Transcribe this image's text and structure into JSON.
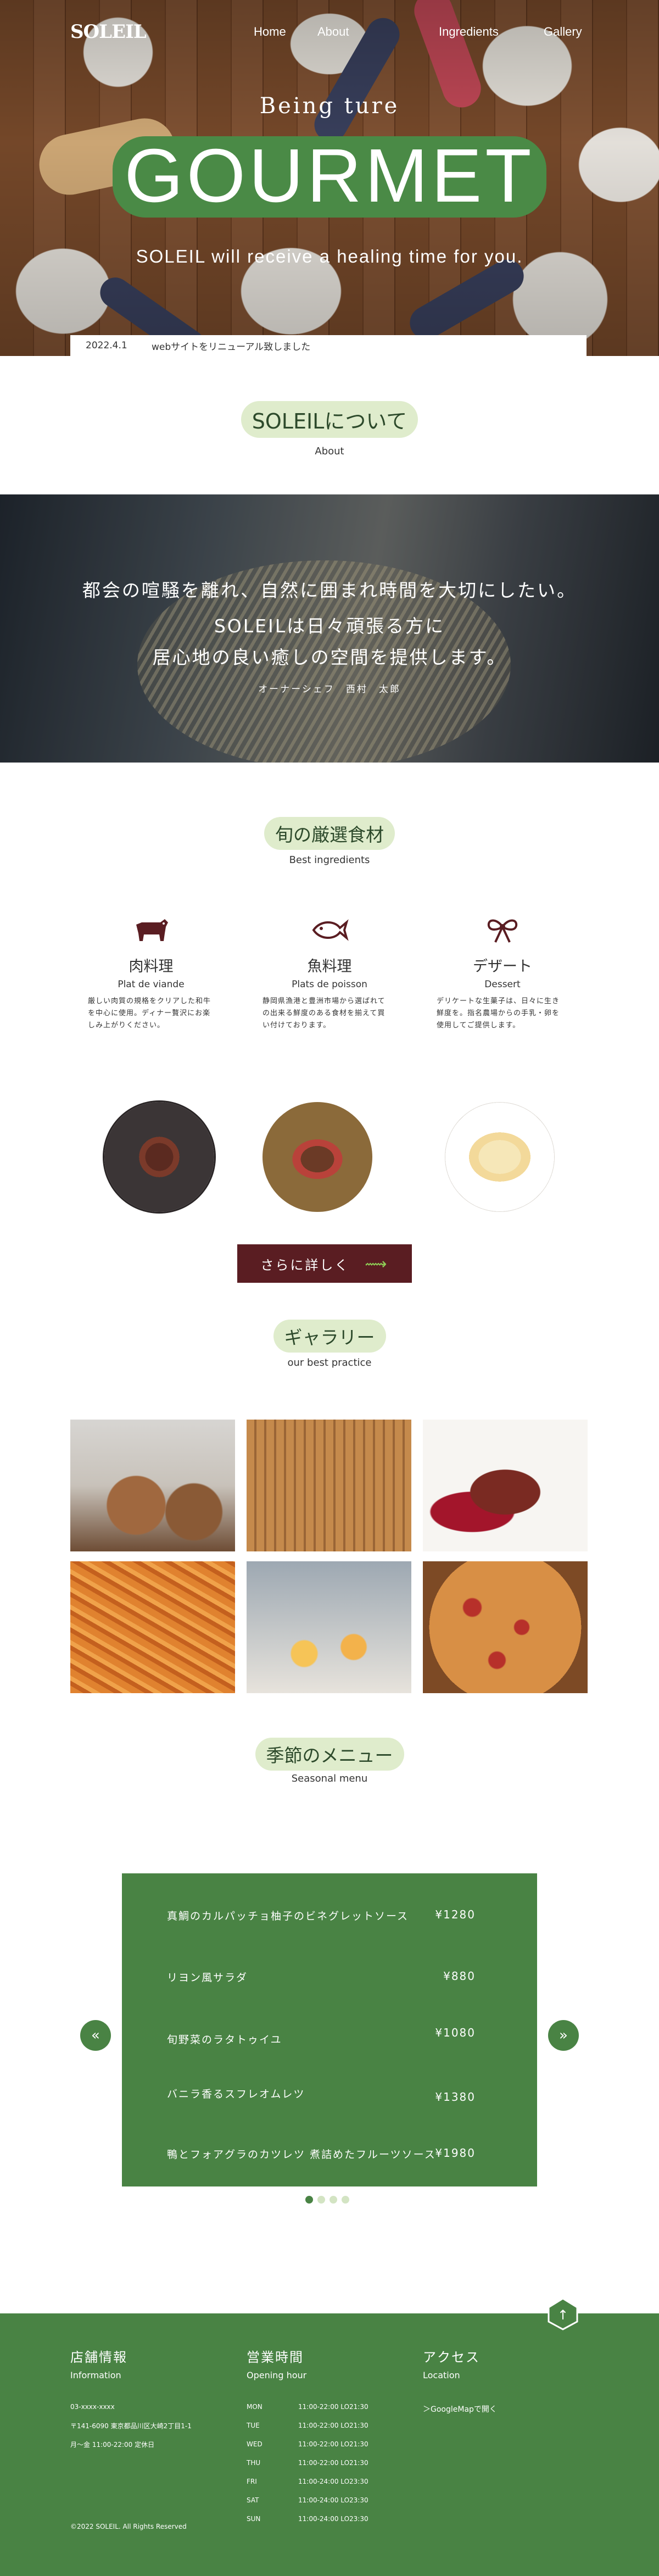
{
  "header": {
    "logo": "SOLEIL",
    "nav": [
      "Home",
      "About",
      "Ingredients",
      "Gallery"
    ]
  },
  "hero": {
    "tagline": "Being ture",
    "title": "GOURMET",
    "subtitle": "SOLEIL will receive a healing time for you."
  },
  "news": {
    "date": "2022.4.1",
    "text": "webサイトをリニューアル致しました"
  },
  "about": {
    "title": "SOLEILについて",
    "sub": "About",
    "lines": [
      "都会の喧騒を離れ、自然に囲まれ時間を大切にしたい。",
      "SOLEILは日々頑張る方に",
      "居心地の良い癒しの空間を提供します。"
    ],
    "signature": "オーナーシェフ　西村　太郎"
  },
  "ingredients": {
    "title": "旬の厳選食材",
    "sub": "Best ingredients",
    "items": [
      {
        "jp": "肉料理",
        "fr": "Plat de viande",
        "icon": "cow-icon",
        "desc": "厳しい肉質の規格をクリアした和牛を中心に使用。ディナー贅沢にお楽しみ上がりください。"
      },
      {
        "jp": "魚料理",
        "fr": "Plats de poisson",
        "icon": "fish-icon",
        "desc": "静岡県漁港と豊洲市場から選ばれての出来る鮮度のある食材を揃えて買い付けております。"
      },
      {
        "jp": "デザート",
        "fr": "Dessert",
        "icon": "ribbon-icon",
        "desc": "デリケートな生菓子は、日々に生き鮮度を。指名農場からの手乳・卵を使用してご提供します。"
      }
    ],
    "more_label": "さらに詳しく",
    "more_arrow": "⟿"
  },
  "gallery": {
    "title": "ギャラリー",
    "sub": "our best practice"
  },
  "menu": {
    "title": "季節のメニュー",
    "sub": "Seasonal menu",
    "items": [
      {
        "name": "真鯛のカルパッチョ柚子のビネグレットソース",
        "price": "¥1280"
      },
      {
        "name": "リヨン風サラダ",
        "price": "¥880"
      },
      {
        "name": "旬野菜のラタトゥイユ",
        "price": "¥1080"
      },
      {
        "name": "バニラ香るスフレオムレツ",
        "price": "¥1380"
      },
      {
        "name": "鴨とフォアグラのカツレツ 煮詰めたフルーツソース",
        "price": "¥1980"
      }
    ],
    "prev": "«",
    "next": "»"
  },
  "footer": {
    "info": {
      "title": "店舗情報",
      "sub": "Information",
      "tel": "03-xxxx-xxxx",
      "address": "〒141-6090 東京都品川区大崎2丁目1-1",
      "holiday": "月～金 11:00-22:00 定休日"
    },
    "hours": {
      "title": "営業時間",
      "sub": "Opening hour",
      "rows": [
        {
          "day": "MON",
          "time": "11:00-22:00 LO21:30"
        },
        {
          "day": "TUE",
          "time": "11:00-22:00 LO21:30"
        },
        {
          "day": "WED",
          "time": "11:00-22:00 LO21:30"
        },
        {
          "day": "THU",
          "time": "11:00-22:00 LO21:30"
        },
        {
          "day": "FRI",
          "time": "11:00-24:00 LO23:30"
        },
        {
          "day": "SAT",
          "time": "11:00-24:00 LO23:30"
        },
        {
          "day": "SUN",
          "time": "11:00-24:00 LO23:30"
        }
      ]
    },
    "access": {
      "title": "アクセス",
      "sub": "Location",
      "map_link": "＞GoogleMapで開く"
    },
    "copyright": "©2022 SOLEIL. All Rights Reserved",
    "top_glyph": "↑"
  },
  "colors": {
    "primary_green": "#498344",
    "light_green": "#dfeccc",
    "wine": "#5a1d22"
  }
}
